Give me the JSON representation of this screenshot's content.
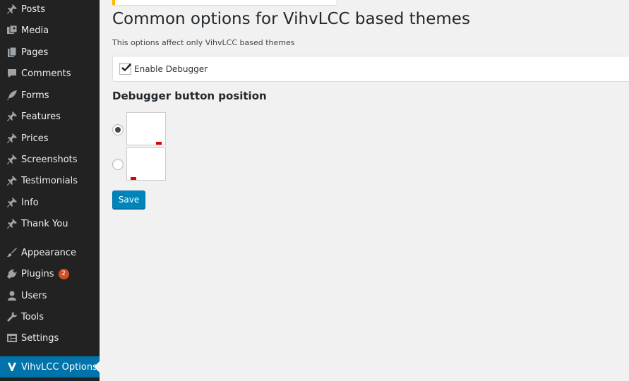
{
  "sidebar": {
    "items": [
      {
        "label": "Posts",
        "icon": "pin-icon"
      },
      {
        "label": "Media",
        "icon": "media-icon"
      },
      {
        "label": "Pages",
        "icon": "pages-icon"
      },
      {
        "label": "Comments",
        "icon": "comment-icon"
      },
      {
        "label": "Forms",
        "icon": "feather-icon"
      },
      {
        "label": "Features",
        "icon": "pin-icon"
      },
      {
        "label": "Prices",
        "icon": "pin-icon"
      },
      {
        "label": "Screenshots",
        "icon": "pin-icon"
      },
      {
        "label": "Testimonials",
        "icon": "pin-icon"
      },
      {
        "label": "Info",
        "icon": "pin-icon"
      },
      {
        "label": "Thank You",
        "icon": "pin-icon"
      },
      {
        "label": "Appearance",
        "icon": "brush-icon"
      },
      {
        "label": "Plugins",
        "icon": "plug-icon",
        "badge": "2"
      },
      {
        "label": "Users",
        "icon": "user-icon"
      },
      {
        "label": "Tools",
        "icon": "wrench-icon"
      },
      {
        "label": "Settings",
        "icon": "settings-icon"
      },
      {
        "label": "VihvLCC Options",
        "icon": "vihv-icon",
        "active": true
      }
    ]
  },
  "main": {
    "title": "Common options for VihvLCC based themes",
    "description": "This options affect only VihvLCC based themes",
    "debugger_label": "Enable Debugger",
    "debugger_checked": true,
    "section_title": "Debugger button position",
    "positions": [
      {
        "name": "bottom-right",
        "selected": true
      },
      {
        "name": "bottom-left",
        "selected": false
      }
    ],
    "save_label": "Save"
  },
  "colors": {
    "sidebar_bg": "#222222",
    "active_bg": "#0073aa",
    "button_bg": "#0085ba",
    "badge_bg": "#d54e21",
    "notice_border": "#ffba00",
    "preview_mark": "#dd0000"
  }
}
